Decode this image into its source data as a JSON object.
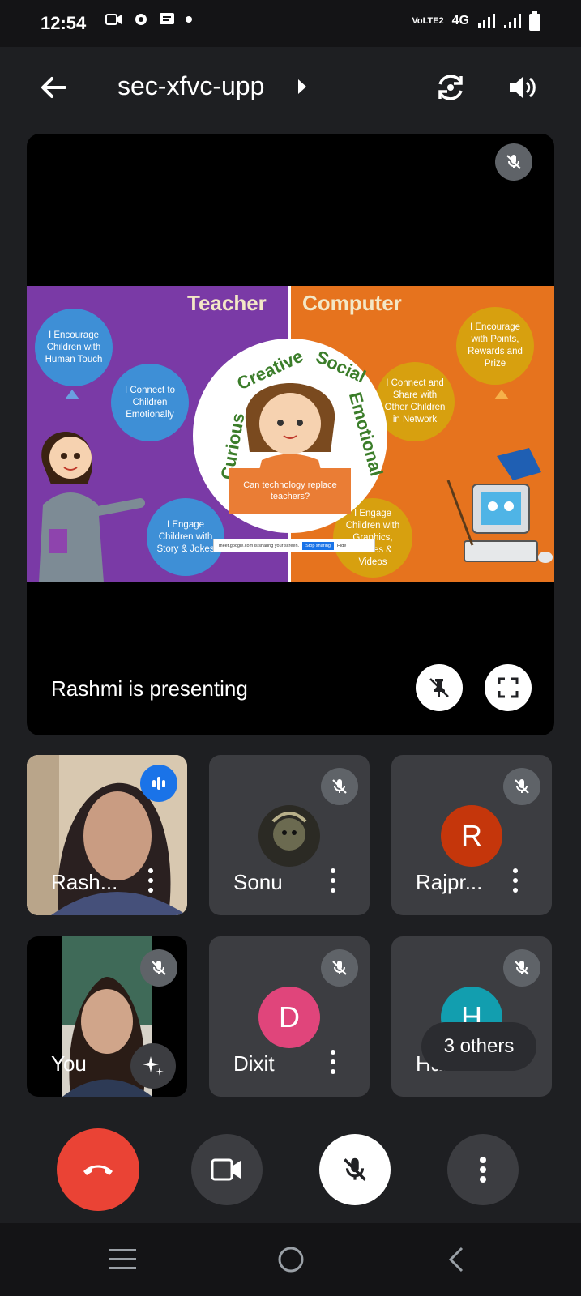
{
  "status_bar": {
    "time": "12:54",
    "network": "4G",
    "volte": "VoLTE2"
  },
  "meeting": {
    "code": "sec-xfvc-upp"
  },
  "presentation": {
    "presenting_text": "Rashmi is presenting",
    "slide": {
      "left_heading": "Teacher",
      "right_heading": "Computer",
      "left_bubbles": [
        "I Encourage Children with Human Touch",
        "I Connect to Children Emotionally",
        "I Engage Children with Story & Jokes"
      ],
      "right_bubbles": [
        "I Encourage with Points, Rewards and Prize",
        "I Connect and Share with Other Children in Network",
        "I Engage Children with Graphics, Games & Videos"
      ],
      "circle_words": [
        "Curious",
        "Creative",
        "Social",
        "Emotional"
      ],
      "question": "Can technology replace teachers?",
      "share_bar": {
        "text": "meet.google.com is sharing your screen.",
        "stop": "Stop sharing",
        "hide": "Hide"
      }
    }
  },
  "participants": [
    {
      "name": "Rash...",
      "type": "video",
      "speaking": true
    },
    {
      "name": "Sonu",
      "type": "photo",
      "muted": true
    },
    {
      "name": "Rajpr...",
      "type": "initial",
      "initial": "R",
      "color": "#c5360b",
      "muted": true
    },
    {
      "name": "You",
      "type": "video",
      "muted": true
    },
    {
      "name": "Dixit",
      "type": "initial",
      "initial": "D",
      "color": "#e0457b",
      "muted": true
    },
    {
      "name": "Har...",
      "type": "initial",
      "initial": "H",
      "color": "#129eaf",
      "muted": true
    }
  ],
  "others_label": "3 others",
  "controls": {
    "end_call_color": "#ea4335"
  }
}
